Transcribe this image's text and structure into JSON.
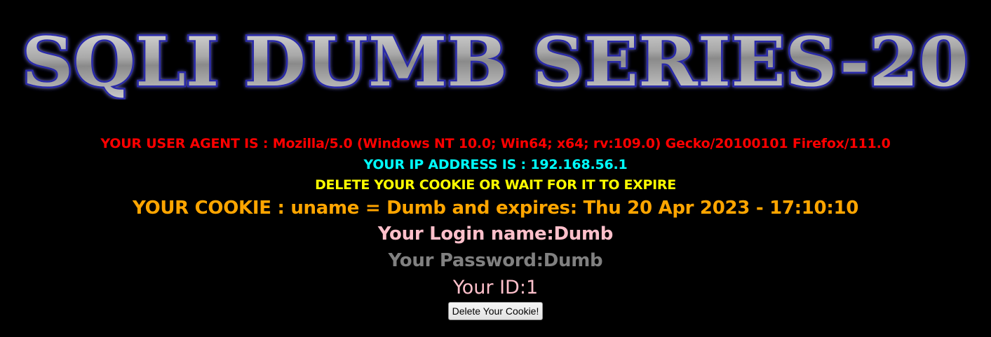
{
  "banner": {
    "title": "SQLI DUMB SERIES-20",
    "colors": {
      "fill_light": "#d9d9d9",
      "fill_dark": "#6e6e6e",
      "outline": "#2a2aa8",
      "glow": "#3b3bd6"
    }
  },
  "info": {
    "user_agent": "YOUR USER AGENT IS : Mozilla/5.0 (Windows NT 10.0; Win64; x64; rv:109.0) Gecko/20100101 Firefox/111.0",
    "ip_address": "YOUR IP ADDRESS IS : 192.168.56.1",
    "delete_notice": "DELETE YOUR COOKIE OR WAIT FOR IT TO EXPIRE",
    "cookie": "YOUR COOKIE : uname = Dumb and expires: Thu 20 Apr 2023 - 17:10:10",
    "login_name": "Your Login name:Dumb",
    "password": "Your Password:Dumb",
    "user_id": "Your ID:1"
  },
  "actions": {
    "delete_cookie_label": "Delete Your Cookie!"
  },
  "colors": {
    "background": "#000000",
    "user_agent": "#ff0000",
    "ip_address": "#00ffff",
    "delete_notice": "#ffff00",
    "cookie": "#ffa500",
    "login_name": "#ffc0cb",
    "password": "#808080",
    "user_id": "#ffc0cb"
  }
}
